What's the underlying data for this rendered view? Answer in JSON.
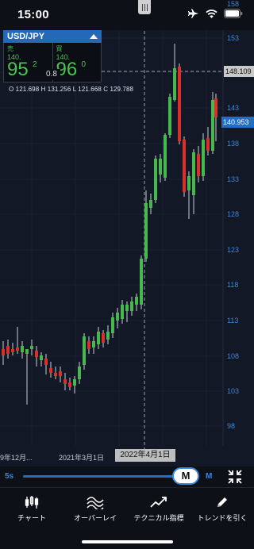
{
  "status_bar": {
    "time": "15:00",
    "icons": [
      "airplane-icon",
      "wifi-icon",
      "battery-icon"
    ]
  },
  "quote_panel": {
    "pair": "USD/JPY",
    "sell": {
      "label": "売",
      "prefix": "140.",
      "big": "95",
      "sup": "2"
    },
    "buy": {
      "label": "買",
      "prefix": "140.",
      "big": "96",
      "sup": "0"
    },
    "spread": "0.8"
  },
  "ohlc": "O 121.698  H 131.256  L 121.668  C 129.788",
  "price_tags": {
    "crosshair": "148.109",
    "last": "140.953"
  },
  "y_axis_labels": [
    "158",
    "153",
    "148",
    "143",
    "138",
    "133",
    "128",
    "123",
    "118",
    "113",
    "108",
    "103",
    "98"
  ],
  "x_axis": {
    "left": "9年12月...",
    "mid": "2021年3月1日",
    "crosshair_date": "2022年4月1日"
  },
  "timeframe": {
    "min": "5s",
    "selected": "M",
    "max": "M"
  },
  "toolbar": {
    "chart": "チャート",
    "overlay": "オーバーレイ",
    "technical": "テクニカル指標",
    "draw": "トレンドを引く"
  },
  "colors": {
    "up": "#46b84e",
    "down": "#d9302b",
    "accent": "#3f86d6",
    "background": "#121826"
  }
}
